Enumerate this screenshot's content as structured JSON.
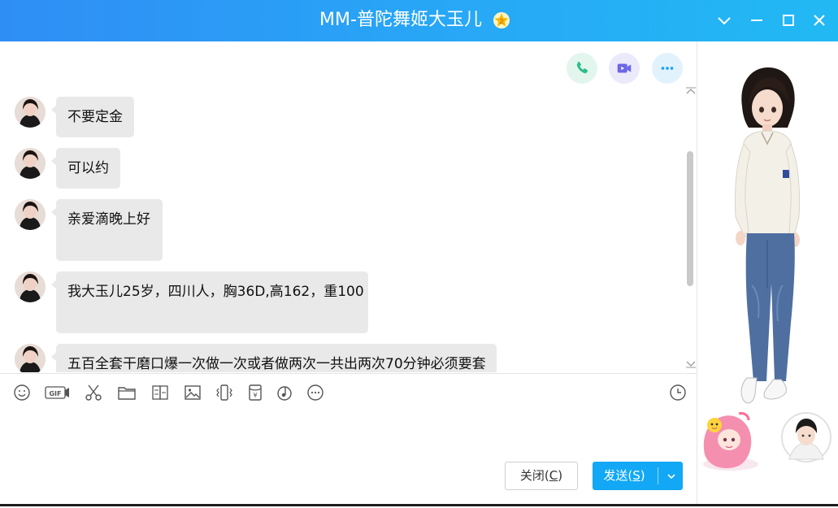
{
  "window": {
    "title": "MM-普陀舞姬大玉儿",
    "vip_icon": "star-badge-icon"
  },
  "titlebar_controls": [
    "chevron-down-icon",
    "minimize-icon",
    "maximize-icon",
    "close-icon"
  ],
  "call_actions": [
    {
      "name": "voice-call-button",
      "icon": "phone-icon",
      "color": "#2bbf8a",
      "bg": "#e3f6ee"
    },
    {
      "name": "video-call-button",
      "icon": "video-icon",
      "color": "#6b66e8",
      "bg": "#ebeafb"
    },
    {
      "name": "more-actions-button",
      "icon": "more-icon",
      "color": "#1ea6ef",
      "bg": "#e2f2fd"
    }
  ],
  "messages": [
    {
      "text": "不要定金"
    },
    {
      "text": "可以约"
    },
    {
      "text": "亲爱滴晚上好"
    },
    {
      "text": "我大玉儿25岁，四川人，胸36D,高162，重100"
    },
    {
      "text": "五百全套干磨口爆一次做一次或者做两次一共出两次70分钟必须要套"
    }
  ],
  "toolbar": {
    "left_tools": [
      "emoji-icon",
      "gif-icon",
      "screenshot-scissors-icon",
      "folder-icon",
      "doc-icon",
      "image-icon",
      "shake-icon",
      "red-packet-icon",
      "music-icon",
      "more-icon"
    ],
    "right_tool": "history-clock-icon"
  },
  "buttons": {
    "close_label": "关闭(",
    "close_hotkey": "C",
    "close_suffix": ")",
    "send_label": "发送(",
    "send_hotkey": "S",
    "send_suffix": ")"
  },
  "colors": {
    "titlebar": "#2f8ef5",
    "send_button": "#12a8f5",
    "bubble": "#e9e9e9"
  }
}
